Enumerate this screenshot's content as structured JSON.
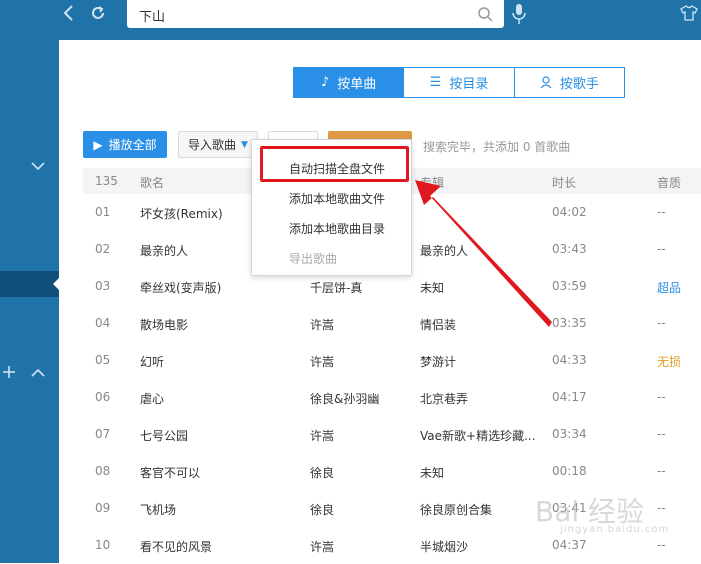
{
  "top_bar": {
    "search_value": "下山",
    "icons": [
      "back-icon",
      "refresh-icon",
      "search-icon",
      "microphone-icon",
      "shirt-icon"
    ]
  },
  "tabs": [
    {
      "label": "按单曲",
      "icon": "music-note-icon",
      "active": true
    },
    {
      "label": "按目录",
      "icon": "list-icon",
      "active": false
    },
    {
      "label": "按歌手",
      "icon": "person-icon",
      "active": false
    }
  ],
  "toolbar": {
    "play_all": "播放全部",
    "import_songs": "导入歌曲",
    "status": "搜索完毕，共添加 0 首歌曲"
  },
  "table": {
    "headers": {
      "count": "135",
      "name": "歌名",
      "album": "专辑",
      "duration": "时长",
      "quality": "音质"
    },
    "rows": [
      {
        "idx": "01",
        "name": "坏女孩(Remix)",
        "artist": "",
        "album": "",
        "time": "04:02",
        "quality": "--"
      },
      {
        "idx": "02",
        "name": "最亲的人",
        "artist": "",
        "album": "最亲的人",
        "time": "03:43",
        "quality": "--"
      },
      {
        "idx": "03",
        "name": "牵丝戏(变声版)",
        "artist": "千层饼-真",
        "album": "未知",
        "time": "03:59",
        "quality": "超品"
      },
      {
        "idx": "04",
        "name": "散场电影",
        "artist": "许嵩",
        "album": "情侣装",
        "time": "03:35",
        "quality": "--"
      },
      {
        "idx": "05",
        "name": "幻听",
        "artist": "许嵩",
        "album": "梦游计",
        "time": "04:33",
        "quality": "无损"
      },
      {
        "idx": "06",
        "name": "虐心",
        "artist": "徐良&孙羽幽",
        "album": "北京巷弄",
        "time": "04:17",
        "quality": "--"
      },
      {
        "idx": "07",
        "name": "七号公园",
        "artist": "许嵩",
        "album": "Vae新歌+精选珍藏...",
        "time": "03:34",
        "quality": "--"
      },
      {
        "idx": "08",
        "name": "客官不可以",
        "artist": "徐良",
        "album": "未知",
        "time": "00:18",
        "quality": "--"
      },
      {
        "idx": "09",
        "name": "飞机场",
        "artist": "徐良",
        "album": "徐良原创合集",
        "time": "03:41",
        "quality": "--"
      },
      {
        "idx": "10",
        "name": "看不见的风景",
        "artist": "许嵩",
        "album": "半城烟沙",
        "time": "04:37",
        "quality": "--"
      }
    ]
  },
  "import_menu": {
    "items": [
      {
        "label": "自动扫描全盘文件",
        "enabled": true
      },
      {
        "label": "添加本地歌曲文件",
        "enabled": true
      },
      {
        "label": "添加本地歌曲目录",
        "enabled": true
      },
      {
        "label": "导出歌曲",
        "enabled": false
      }
    ]
  },
  "watermark": {
    "text": "Bai 经验",
    "sub": "jingyan.baidu.com"
  },
  "colors": {
    "brand": "#1f73a8",
    "accent": "#2a8fe6",
    "highlight": "#e0191e",
    "lossless": "#e0a020"
  }
}
